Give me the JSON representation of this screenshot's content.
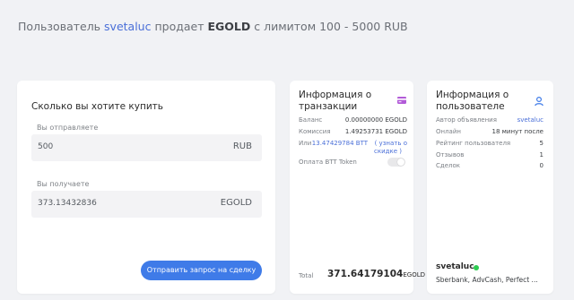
{
  "header": {
    "prefix": "Пользователь",
    "username": "svetaluc",
    "middle": "продает",
    "asset": "EGOLD",
    "limit_text": "с лимитом 100 - 5000 RUB"
  },
  "buy": {
    "title": "Сколько вы хотите купить",
    "send_label": "Вы отправляете",
    "send_value": "500",
    "send_currency": "RUB",
    "receive_label": "Вы получаете",
    "receive_value": "373.13432836",
    "receive_currency": "EGOLD",
    "submit_label": "Отправить запрос на сделку"
  },
  "transaction": {
    "title_line1": "Информация о",
    "title_line2": "транзакции",
    "icon": "card-icon",
    "rows": [
      {
        "key": "Баланс",
        "value": "0.00000000 EGOLD"
      },
      {
        "key": "Комиссия",
        "value": "1.49253731 EGOLD"
      },
      {
        "key": "Или",
        "value": "13.47429784 BTT",
        "value_link": "( узнать о",
        "value_link2": "скидке )"
      }
    ],
    "toggle_label": "Оплата BTT Token",
    "total_label": "Total",
    "total_value": "371.64179104",
    "total_currency": "EGOLD"
  },
  "user_info": {
    "title_line1": "Информация о",
    "title_line2": "пользователе",
    "icon": "user-icon",
    "rows": [
      {
        "key": "Автор объявления",
        "value": "svetaluc"
      },
      {
        "key": "Онлайн",
        "value": "18 минут после"
      },
      {
        "key": "Рейтинг пользователя",
        "value": "5"
      },
      {
        "key": "Отзывов",
        "value": "1"
      },
      {
        "key": "Сделок",
        "value": "0"
      }
    ],
    "username": "svetaluc",
    "status_color": "#2ecc52",
    "payment_methods": "Sberbank, AdvCash, Perfect ..."
  },
  "colors": {
    "accent": "#3f7be8",
    "link": "#4a6fd8",
    "background": "#f1f2f5"
  }
}
